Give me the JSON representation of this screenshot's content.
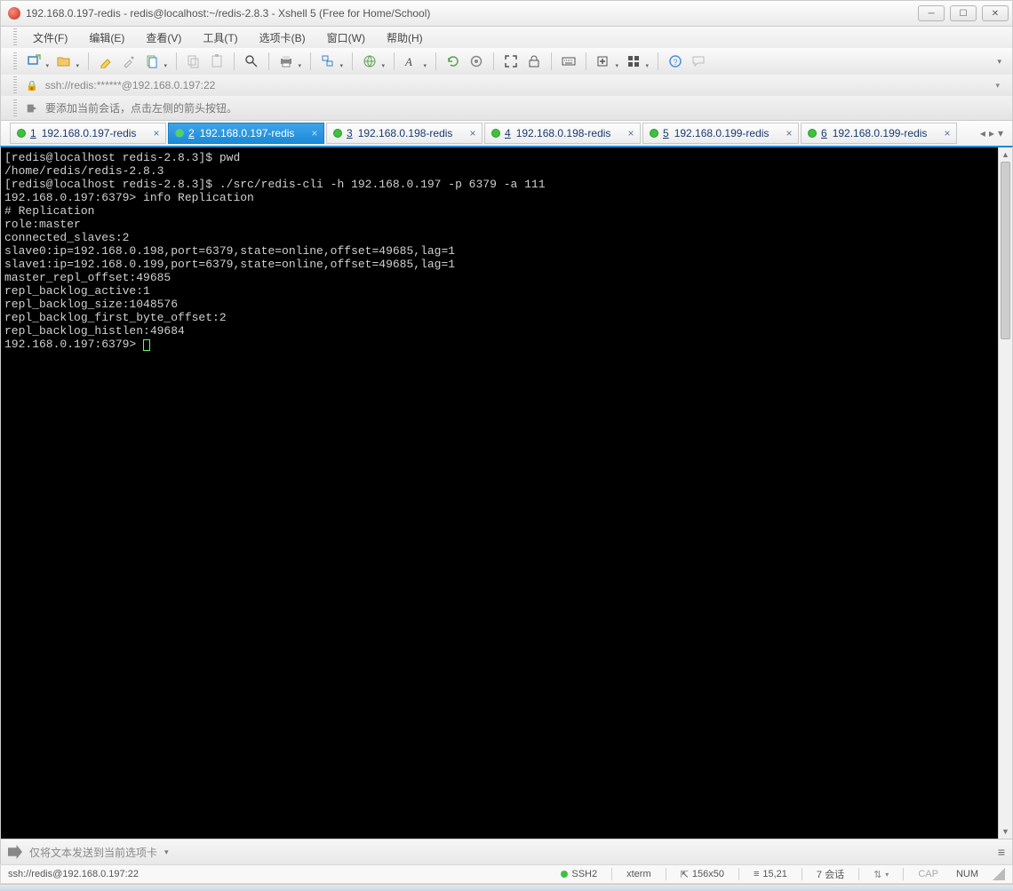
{
  "window": {
    "title": "192.168.0.197-redis - redis@localhost:~/redis-2.8.3 - Xshell 5 (Free for Home/School)"
  },
  "menubar": {
    "items": [
      "文件(F)",
      "编辑(E)",
      "查看(V)",
      "工具(T)",
      "选项卡(B)",
      "窗口(W)",
      "帮助(H)"
    ]
  },
  "addressbar": {
    "url": "ssh://redis:******@192.168.0.197:22"
  },
  "infobar": {
    "message": "要添加当前会话，点击左侧的箭头按钮。"
  },
  "tabs": [
    {
      "num": "1",
      "label": "192.168.0.197-redis",
      "active": false
    },
    {
      "num": "2",
      "label": "192.168.0.197-redis",
      "active": true
    },
    {
      "num": "3",
      "label": "192.168.0.198-redis",
      "active": false
    },
    {
      "num": "4",
      "label": "192.168.0.198-redis",
      "active": false
    },
    {
      "num": "5",
      "label": "192.168.0.199-redis",
      "active": false
    },
    {
      "num": "6",
      "label": "192.168.0.199-redis",
      "active": false
    }
  ],
  "terminal": {
    "lines": [
      "[redis@localhost redis-2.8.3]$ pwd",
      "/home/redis/redis-2.8.3",
      "[redis@localhost redis-2.8.3]$ ./src/redis-cli -h 192.168.0.197 -p 6379 -a 111",
      "192.168.0.197:6379> info Replication",
      "# Replication",
      "role:master",
      "connected_slaves:2",
      "slave0:ip=192.168.0.198,port=6379,state=online,offset=49685,lag=1",
      "slave1:ip=192.168.0.199,port=6379,state=online,offset=49685,lag=1",
      "master_repl_offset:49685",
      "repl_backlog_active:1",
      "repl_backlog_size:1048576",
      "repl_backlog_first_byte_offset:2",
      "repl_backlog_histlen:49684"
    ],
    "prompt": "192.168.0.197:6379> "
  },
  "sendbar": {
    "placeholder": "仅将文本发送到当前选项卡"
  },
  "statusbar": {
    "conn": "ssh://redis@192.168.0.197:22",
    "proto": "SSH2",
    "term": "xterm",
    "size": "156x50",
    "cursor": "15,21",
    "sessions": "7 会话",
    "cap": "CAP",
    "num": "NUM"
  }
}
